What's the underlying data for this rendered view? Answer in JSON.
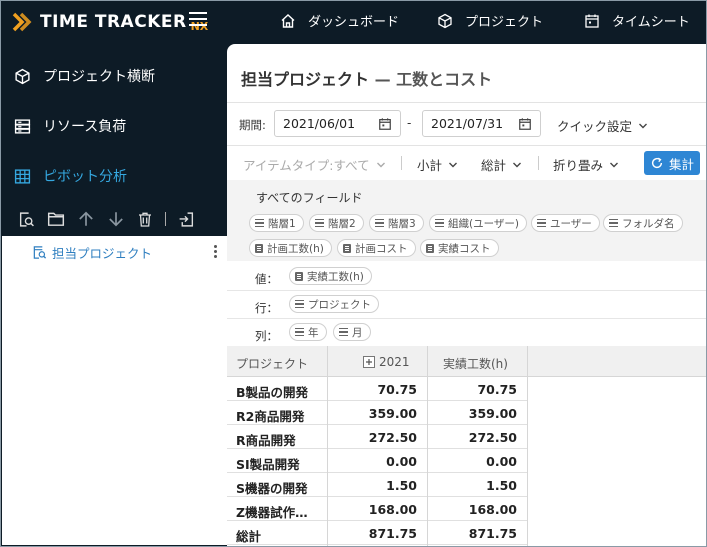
{
  "app": {
    "logo_text": "TIME TRACKER",
    "logo_suffix": "NX",
    "brand_accent": "#f0a020",
    "nav": [
      {
        "label": "ダッシュボード",
        "icon": "home-icon"
      },
      {
        "label": "プロジェクト",
        "icon": "cube-icon"
      },
      {
        "label": "タイムシート",
        "icon": "calendar-icon"
      }
    ]
  },
  "sidebar": {
    "items": [
      {
        "label": "プロジェクト横断",
        "icon": "cube-icon"
      },
      {
        "label": "リソース負荷",
        "icon": "server-icon"
      },
      {
        "label": "ピボット分析",
        "icon": "grid-icon",
        "active": true
      }
    ],
    "active_color": "#35a8e0",
    "tools": [
      "search-doc-icon",
      "folder-icon",
      "arrow-up-icon",
      "arrow-down-icon",
      "trash-icon",
      "export-icon"
    ],
    "tree": [
      {
        "label": "担当プロジェクト",
        "icon": "report-search-icon"
      }
    ]
  },
  "main": {
    "title": "担当プロジェクト",
    "title_sub": "— 工数とコスト",
    "period_label": "期間:",
    "date_from": "2021/06/01",
    "date_sep": "-",
    "date_to": "2021/07/31",
    "quick_settings": "クイック設定",
    "toolbar": {
      "item_type": "アイテムタイプ:すべて",
      "subtotal": "小計",
      "total": "総計",
      "fold": "折り畳み",
      "aggregate": "集計"
    },
    "primary_color": "#2e86d4",
    "fields_title": "すべてのフィールド",
    "fields": [
      {
        "label": "階層1",
        "kind": "dim"
      },
      {
        "label": "階層2",
        "kind": "dim"
      },
      {
        "label": "階層3",
        "kind": "dim"
      },
      {
        "label": "組織(ユーザー)",
        "kind": "dim"
      },
      {
        "label": "ユーザー",
        "kind": "dim"
      },
      {
        "label": "フォルダ名",
        "kind": "dim"
      },
      {
        "label": "計画工数(h)",
        "kind": "measure"
      },
      {
        "label": "計画コスト",
        "kind": "measure"
      },
      {
        "label": "実績コスト",
        "kind": "measure"
      }
    ],
    "zones": {
      "values_label": "値：",
      "values": [
        "実績工数(h)"
      ],
      "rows_label": "行：",
      "rows": [
        "プロジェクト"
      ],
      "cols_label": "列：",
      "cols": [
        "年",
        "月"
      ]
    },
    "table": {
      "headers": [
        "プロジェクト",
        "2021",
        "実績工数(h)"
      ],
      "rows": [
        {
          "name": "B製品の開発",
          "v2021": "70.75",
          "total": "70.75"
        },
        {
          "name": "R2商品開発",
          "v2021": "359.00",
          "total": "359.00"
        },
        {
          "name": "R商品開発",
          "v2021": "272.50",
          "total": "272.50"
        },
        {
          "name": "SI製品開発",
          "v2021": "0.00",
          "total": "0.00"
        },
        {
          "name": "S機器の開発",
          "v2021": "1.50",
          "total": "1.50"
        },
        {
          "name": "Z機器試作…",
          "v2021": "168.00",
          "total": "168.00"
        },
        {
          "name": "総計",
          "v2021": "871.75",
          "total": "871.75"
        }
      ]
    }
  }
}
